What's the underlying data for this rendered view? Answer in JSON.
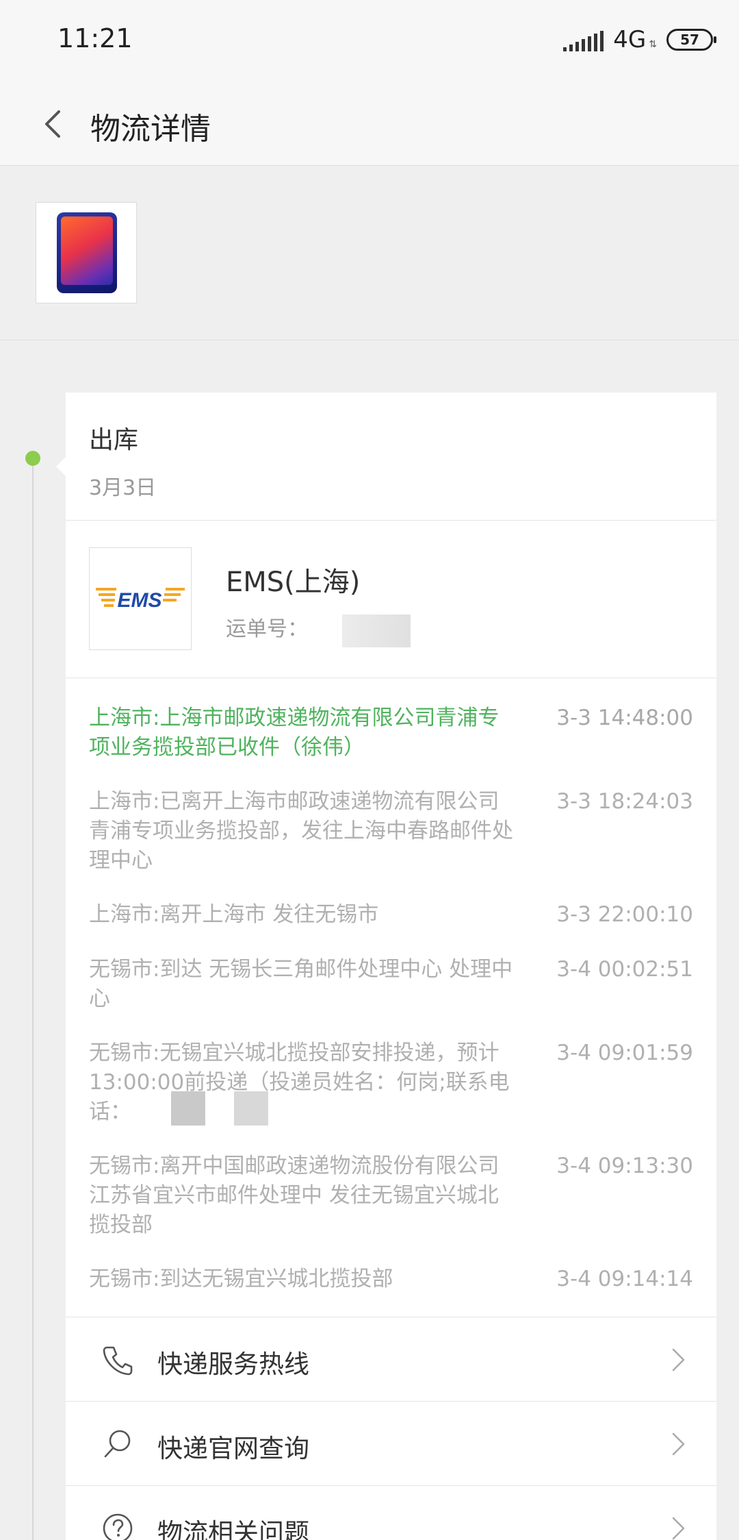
{
  "status_bar": {
    "time": "11:21",
    "network": "4G",
    "battery": "57"
  },
  "header": {
    "title": "物流详情"
  },
  "stage": {
    "title": "出库",
    "date": "3月3日"
  },
  "carrier": {
    "name": "EMS(上海)",
    "waybill_label": "运单号："
  },
  "events": [
    {
      "text": "上海市:上海市邮政速递物流有限公司青浦专项业务揽投部已收件（徐伟）",
      "time": "3-3 14:48:00",
      "current": true
    },
    {
      "text": "上海市:已离开上海市邮政速递物流有限公司青浦专项业务揽投部，发往上海中春路邮件处理中心",
      "time": "3-3 18:24:03",
      "current": false
    },
    {
      "text": "上海市:离开上海市 发往无锡市",
      "time": "3-3 22:00:10",
      "current": false
    },
    {
      "text": "无锡市:到达 无锡长三角邮件处理中心 处理中心",
      "time": "3-4 00:02:51",
      "current": false
    },
    {
      "text": "无锡市:无锡宜兴城北揽投部安排投递，预计13:00:00前投递（投递员姓名：何岗;联系电话：",
      "time": "3-4 09:01:59",
      "current": false
    },
    {
      "text": "无锡市:离开中国邮政速递物流股份有限公司江苏省宜兴市邮件处理中 发往无锡宜兴城北揽投部",
      "time": "3-4 09:13:30",
      "current": false
    },
    {
      "text": "无锡市:到达无锡宜兴城北揽投部",
      "time": "3-4 09:14:14",
      "current": false
    }
  ],
  "menu": [
    {
      "label": "快递服务热线",
      "icon": "phone-icon"
    },
    {
      "label": "快递官网查询",
      "icon": "search-icon"
    },
    {
      "label": "物流相关问题",
      "icon": "help-icon"
    }
  ],
  "colors": {
    "accent": "#4fb35e",
    "timeline_dot": "#8dcc4e",
    "muted_text": "#b0b0b0"
  }
}
